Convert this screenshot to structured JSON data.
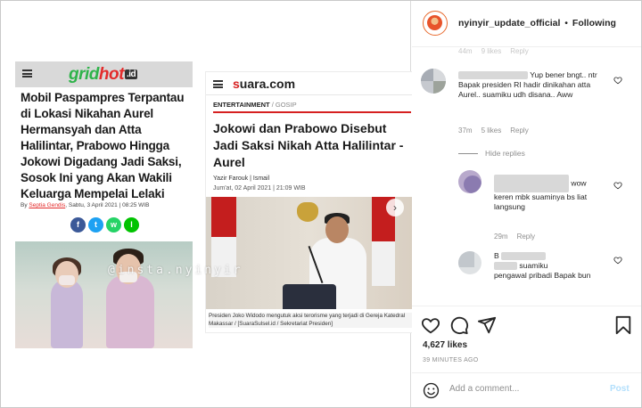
{
  "post": {
    "username": "nyinyir_update_official",
    "separator": "•",
    "follow_label": "Following",
    "likes": "4,627 likes",
    "time_ago": "39 MINUTES AGO",
    "add_comment_placeholder": "Add a comment...",
    "post_label": "Post"
  },
  "media": {
    "watermark": "@insta.nyinyir",
    "gridhot": {
      "logo_main": "grid",
      "logo_hot": "hot",
      "logo_tld": ".id",
      "headline": "Mobil Paspampres Terpantau di Lokasi Nikahan Aurel Hermansyah dan Atta Halilintar, Prabowo Hingga Jokowi Digadang Jadi Saksi, Sosok Ini yang Akan Wakili Keluarga Mempelai Lelaki",
      "byline_prefix": "By ",
      "author": "Septia Gendis",
      "byline_date": ", Sabtu, 3 April 2021 | 08:25 WIB",
      "share": [
        "f",
        "t",
        "w",
        "l"
      ]
    },
    "suara": {
      "logo_s": "s",
      "logo_rest": "uara.com",
      "category": "ENTERTAINMENT",
      "category_sep": " / ",
      "subcategory": "GOSIP",
      "headline": "Jokowi dan Prabowo Disebut Jadi Saksi Nikah Atta Halilintar - Aurel",
      "author": "Yazir Farouk | Ismail",
      "date": "Jum'at, 02 April 2021 | 21:09 WIB",
      "next_glyph": "›",
      "caption": "Presiden Joko Widodo mengutuk aksi terorisme yang terjadi di Gereja Katedral Makassar / [SuaraSulsel.id / Sekretariat Presiden]"
    }
  },
  "comments": {
    "faded_meta": [
      "44m",
      "9 likes",
      "Reply"
    ],
    "c1": {
      "text": "Yup bener bngt.. ntr Bapak presiden RI hadir dinikahan atta Aurel.. suamiku udh disana.. Aww",
      "meta": [
        "37m",
        "5 likes",
        "Reply"
      ]
    },
    "hide_replies": "Hide replies",
    "c2": {
      "text_a": "wow",
      "text_b": "keren mbk suaminya bs liat langsung",
      "meta": [
        "29m",
        "Reply"
      ]
    },
    "c3": {
      "text_lead": "B",
      "text_a": "suamiku",
      "text_b": "pengawal pribadi Bapak bun"
    }
  },
  "colors": {
    "accent_blue": "#0095f6",
    "post_disabled": "#b2dffc",
    "meta_gray": "#8e8e8e",
    "gridhot_green": "#2eb34a",
    "suara_red": "#d62020"
  },
  "icons": {
    "like": "heart-icon",
    "comment": "comment-icon",
    "share": "paper-plane-icon",
    "save": "bookmark-icon",
    "emoji": "smiley-icon"
  }
}
